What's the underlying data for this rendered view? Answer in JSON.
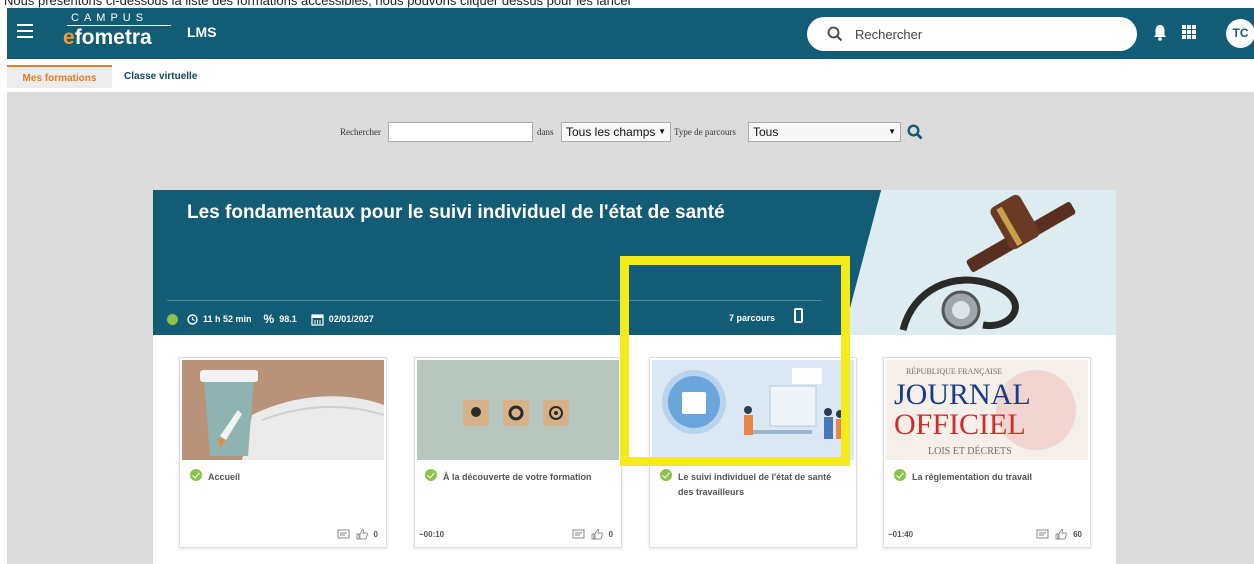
{
  "header": {
    "top_caption": "Nous présentons ci-dessous la liste des formations accessibles, nous pouvons cliquer dessus pour les lancer",
    "logo_campus": "CAMPUS",
    "logo_e": "e",
    "logo_name": "fometra",
    "app_name": "LMS",
    "search_placeholder": "Rechercher",
    "avatar_initials": "TC"
  },
  "tabs": [
    {
      "label": "Mes formations",
      "active": true
    },
    {
      "label": "Classe virtuelle",
      "active": false
    }
  ],
  "filter": {
    "search_label": "Rechercher",
    "search_value": "",
    "in_label": "dans",
    "field_select": "Tous les champs",
    "type_label": "Type de parcours",
    "type_select": "Tous"
  },
  "banner": {
    "title": "Les fondamentaux pour le suivi individuel de l'état de santé",
    "duration": "11 h 52 min",
    "percent": "98.1",
    "date": "02/01/2027",
    "parcours_count": "7 parcours"
  },
  "cards": [
    {
      "title": "Accueil",
      "duration": "",
      "comments": "",
      "likes": "0"
    },
    {
      "title": "À la découverte de votre formation",
      "duration": "~00:10",
      "comments": "",
      "likes": "0"
    },
    {
      "title": "Le suivi individuel de l'état de santé des travailleurs",
      "duration": "",
      "comments": "",
      "likes": ""
    },
    {
      "title": "La réglementation du travail",
      "duration": "~01:40",
      "comments": "",
      "likes": "60"
    }
  ],
  "journal_image": {
    "line1": "RÉPUBLIQUE FRANÇAISE",
    "line2": "JOURNAL",
    "line3": "OFFICIEL",
    "line4": "LOIS ET DÉCRETS"
  },
  "colors": {
    "brand": "#135c75",
    "accent": "#e07b26",
    "highlight": "#f4ec1a",
    "check": "#8bc34a"
  }
}
